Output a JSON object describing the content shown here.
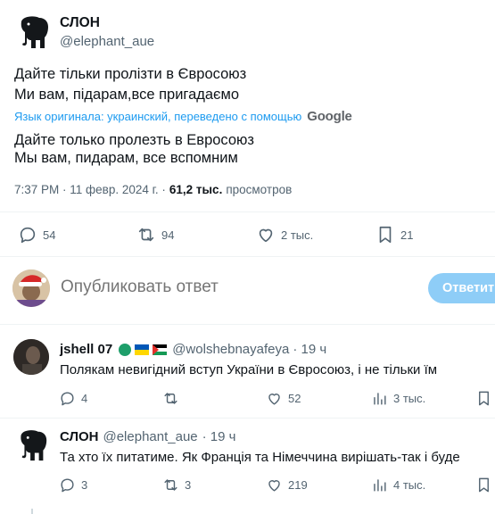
{
  "tweet": {
    "author_name": "СЛОН",
    "author_handle": "@elephant_aue",
    "text_line1": "Дайте тільки пролізти в Євросоюз",
    "text_line2": "Ми вам, підарам,все пригадаємо",
    "translation_note": "Язык оригинала: украинский, переведено с помощью",
    "translation_provider": "Google",
    "translated_line1": "Дайте только пролезть в Евросоюз",
    "translated_line2": "Мы вам, пидарам, все вспомним",
    "timestamp": "7:37 PM · 11 февр. 2024 г. ·",
    "views_count": "61,2 тыс.",
    "views_label": "просмотров",
    "stats": {
      "replies": "54",
      "retweets": "94",
      "likes": "2 тыс.",
      "bookmarks": "21"
    }
  },
  "composer": {
    "placeholder": "Опубликовать ответ",
    "button_label": "Ответить"
  },
  "replies": [
    {
      "author_name": "jshell 07",
      "author_handle": "@wolshebnayafeya",
      "time": "· 19 ч",
      "text": "Полякам невигідний вступ України в Євросоюз, і не тільки їм",
      "stats": {
        "replies": "4",
        "retweets": "",
        "likes": "52",
        "views": "3 тыс."
      }
    },
    {
      "author_name": "СЛОН",
      "author_handle": "@elephant_aue",
      "time": "· 19 ч",
      "text": "Та хто їх питатиме. Як Франція та Німеччина вирішать-так і буде",
      "stats": {
        "replies": "3",
        "retweets": "3",
        "likes": "219",
        "views": "4 тыс."
      }
    }
  ],
  "colors": {
    "accent": "#1d9bf0",
    "button_disabled": "#8ecdf7",
    "secondary_text": "#536471",
    "divider": "#eff3f4"
  }
}
